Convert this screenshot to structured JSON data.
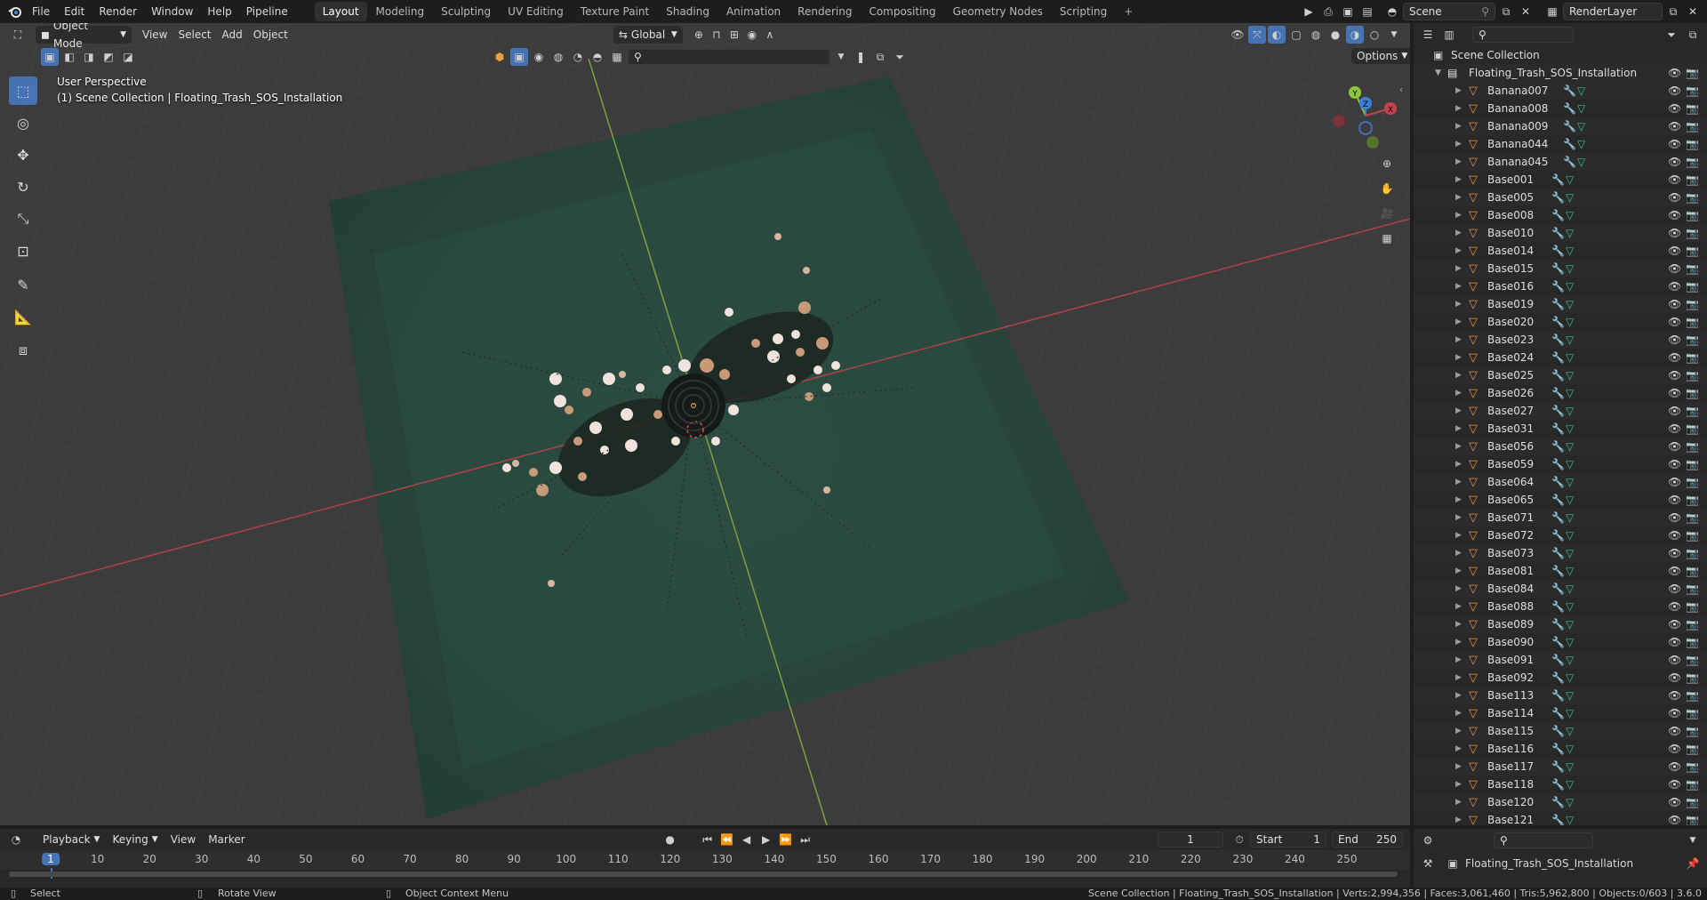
{
  "topbar": {
    "menus": [
      "File",
      "Edit",
      "Render",
      "Window",
      "Help",
      "Pipeline"
    ],
    "workspaces": [
      "Layout",
      "Modeling",
      "Sculpting",
      "UV Editing",
      "Texture Paint",
      "Shading",
      "Animation",
      "Rendering",
      "Compositing",
      "Geometry Nodes",
      "Scripting"
    ],
    "active_workspace": "Layout",
    "scene_name": "Scene",
    "view_layer": "RenderLayer"
  },
  "viewport_header": {
    "mode": "Object Mode",
    "menus": [
      "View",
      "Select",
      "Add",
      "Object"
    ],
    "orientation": "Global",
    "options_label": "Options"
  },
  "viewport": {
    "view_name": "User Perspective",
    "context": "(1) Scene Collection | Floating_Trash_SOS_Installation",
    "gizmo_axes": [
      "Y",
      "Z",
      "X"
    ],
    "colors": {
      "x_axis": "#c8414f",
      "y_axis": "#8cc63f",
      "z_axis": "#3b7fd8",
      "ground": "#2f5a4a"
    }
  },
  "outliner": {
    "root": "Scene Collection",
    "collection": "Floating_Trash_SOS_Installation",
    "items": [
      "Banana007",
      "Banana008",
      "Banana009",
      "Banana044",
      "Banana045",
      "Base001",
      "Base005",
      "Base008",
      "Base010",
      "Base014",
      "Base015",
      "Base016",
      "Base019",
      "Base020",
      "Base023",
      "Base024",
      "Base025",
      "Base026",
      "Base027",
      "Base031",
      "Base056",
      "Base059",
      "Base064",
      "Base065",
      "Base071",
      "Base072",
      "Base073",
      "Base081",
      "Base084",
      "Base088",
      "Base089",
      "Base090",
      "Base091",
      "Base092",
      "Base113",
      "Base114",
      "Base115",
      "Base116",
      "Base117",
      "Base118",
      "Base120",
      "Base121"
    ]
  },
  "properties": {
    "active_object": "Floating_Trash_SOS_Installation"
  },
  "timeline": {
    "menus": [
      "Playback",
      "Keying",
      "View",
      "Marker"
    ],
    "current_frame": "1",
    "start_label": "Start",
    "start_value": "1",
    "end_label": "End",
    "end_value": "250",
    "ruler": [
      "1",
      "10",
      "20",
      "30",
      "40",
      "50",
      "60",
      "70",
      "80",
      "90",
      "100",
      "110",
      "120",
      "130",
      "140",
      "150",
      "160",
      "170",
      "180",
      "190",
      "200",
      "210",
      "220",
      "230",
      "240",
      "250"
    ]
  },
  "statusbar": {
    "left_hint": "Select",
    "middle_hint": "Rotate View",
    "right_hint": "Object Context Menu",
    "stats": "Scene Collection | Floating_Trash_SOS_Installation | Verts:2,994,356 | Faces:3,061,460 | Tris:5,962,800 | Objects:0/603 | 3.6.0"
  }
}
